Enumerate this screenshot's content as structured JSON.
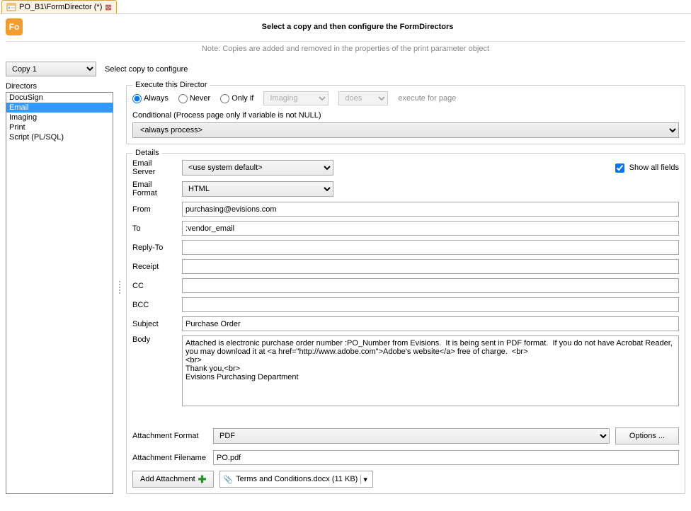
{
  "tab": {
    "title": "PO_B1\\FormDirector (*)"
  },
  "header": {
    "badge": "Fo",
    "title": "Select a copy and then configure the FormDirectors"
  },
  "note": "Note: Copies are added and removed in the properties of the print parameter object",
  "copy": {
    "selected": "Copy 1",
    "hint": "Select copy to configure"
  },
  "directors": {
    "label": "Directors",
    "items": [
      "DocuSign",
      "Email",
      "Imaging",
      "Print",
      "Script (PL/SQL)"
    ],
    "selected": "Email"
  },
  "exec": {
    "legend": "Execute this Director",
    "options": {
      "always": "Always",
      "never": "Never",
      "onlyif": "Only if"
    },
    "selected": "always",
    "var_select": "Imaging",
    "op_select": "does",
    "hint": "execute for page",
    "cond_label": "Conditional (Process page only if variable is not NULL)",
    "cond_value": "<always process>"
  },
  "details": {
    "legend": "Details",
    "labels": {
      "server": "Email Server",
      "format": "Email Format",
      "from": "From",
      "to": "To",
      "reply": "Reply-To",
      "receipt": "Receipt",
      "cc": "CC",
      "bcc": "BCC",
      "subject": "Subject",
      "body": "Body",
      "att_format": "Attachment Format",
      "att_filename": "Attachment Filename"
    },
    "server": "<use system default>",
    "format": "HTML",
    "from": "purchasing@evisions.com",
    "to": ":vendor_email",
    "reply": "",
    "receipt": "",
    "cc": "",
    "bcc": "",
    "subject": "Purchase Order",
    "body": "Attached is electronic purchase order number :PO_Number from Evisions.  It is being sent in PDF format.  If you do not have Acrobat Reader, you may download it at <a href=\"http://www.adobe.com\">Adobe's website</a> free of charge.  <br>\n<br>\nThank you,<br>\nEvisions Purchasing Department",
    "show_all": "Show all fields",
    "att_format": "PDF",
    "options_btn": "Options ...",
    "att_filename": "PO.pdf",
    "add_attach": "Add Attachment",
    "attachment_chip": "Terms and Conditions.docx (11 KB)"
  }
}
